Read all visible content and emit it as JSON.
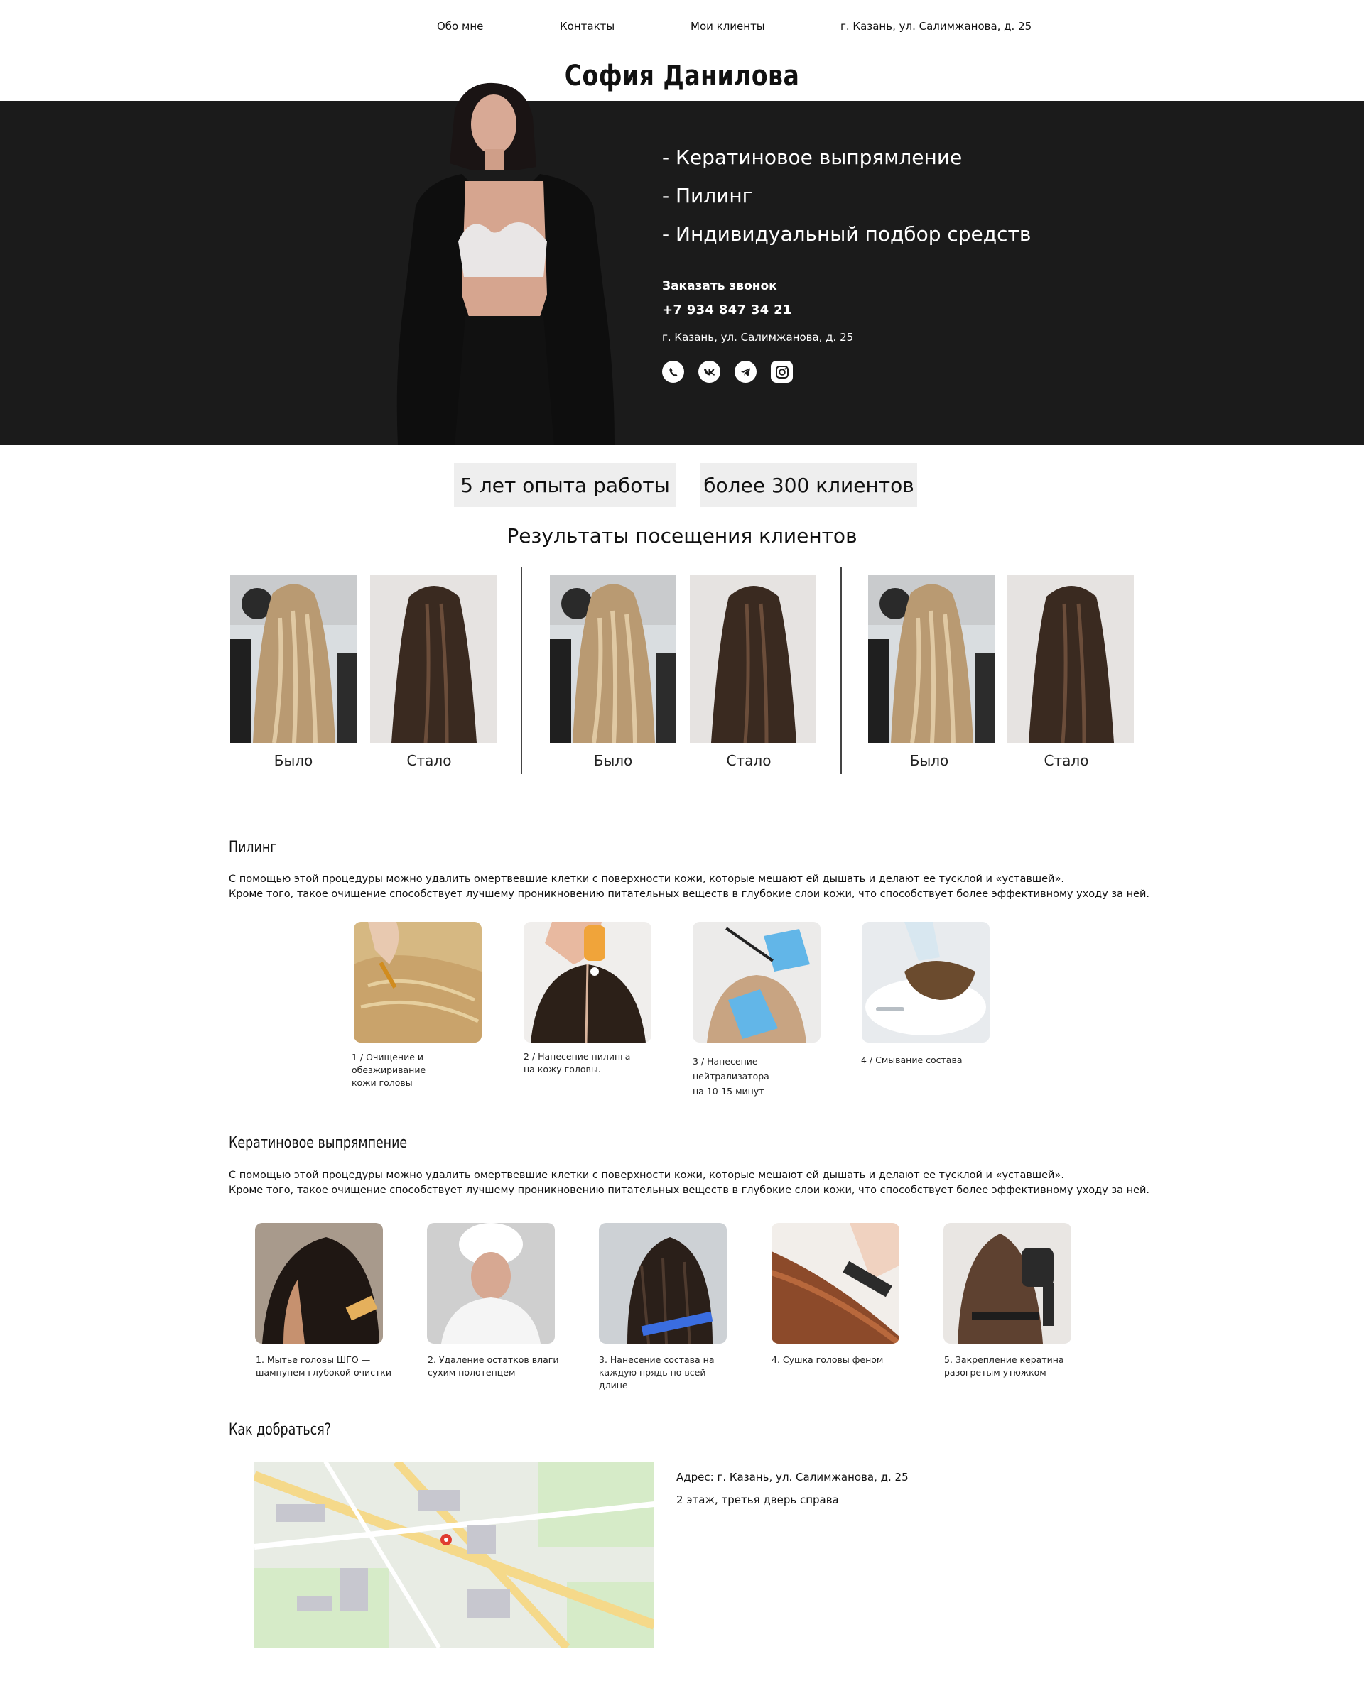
{
  "nav": {
    "about": "Обо мне",
    "contacts": "Контакты",
    "clients": "Мои клиенты",
    "address": "г. Казань, ул. Салимжанова, д. 25"
  },
  "title": "София Данилова",
  "hero": {
    "services": [
      "- Кератиновое выпрямление",
      "- Пилинг",
      "- Индивидуальный подбор средств"
    ],
    "call_label": "Заказать звонок",
    "phone": "+7 934 847 34 21",
    "address": "г. Казань, ул. Салимжанова, д. 25",
    "socials": [
      "whatsapp-icon",
      "vk-icon",
      "telegram-icon",
      "instagram-icon"
    ]
  },
  "stats": {
    "experience": "5 лет опыта работы",
    "clients": "более 300 клиентов"
  },
  "results": {
    "title": "Результаты посещения клиентов",
    "before": "Было",
    "after": "Стало"
  },
  "peeling": {
    "title": "Пилинг",
    "text1": "С помощью этой процедуры можно удалить омертвевшие клетки с поверхности кожи, которые мешают ей дышать и делают ее тусклой и «уставшей».",
    "text2": "Кроме того, такое очищение способствует лучшему проникновению питательных веществ в глубокие слои кожи, что способствует более эффективному уходу за ней.",
    "steps": [
      "1 / Очищение и\nобезжиривание\nкожи головы",
      "2 / Нанесение пилинга\nна кожу головы.",
      "3 / Нанесение\nнейтрализатора\nна 10-15 минут",
      "4 / Смывание состава"
    ]
  },
  "keratin": {
    "title": "Кератиновое выпрямпение",
    "text1": "С помощью этой процедуры можно удалить омертвевшие клетки с поверхности кожи, которые мешают ей дышать и делают ее тусклой и «уставшей».",
    "text2": "Кроме того, такое очищение способствует лучшему проникновению питательных веществ в глубокие слои кожи, что способствует более эффективному уходу за ней.",
    "steps": [
      "1. Мытье головы ШГО —\nшампунем глубокой очистки",
      "2. Удаление остатков влаги\nсухим полотенцем",
      "3. Нанесение состава на\nкаждую прядь по всей\nдлине",
      "4. Сушка головы феном",
      "5. Закрепление кератина\nразогретым утюжком"
    ]
  },
  "location": {
    "title": "Как добраться?",
    "address": "Адрес: г. Казань, ул. Салимжанова, д. 25",
    "details": "2 этаж, третья дверь справа"
  },
  "colors": {
    "hero_bg": "#1b1b1b",
    "stat_bg": "#eeeeee"
  }
}
